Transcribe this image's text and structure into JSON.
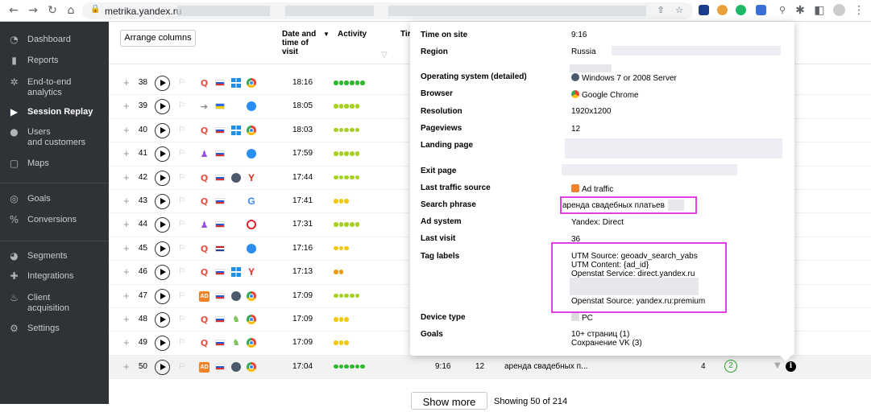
{
  "browser": {
    "url": "metrika.yandex.ru"
  },
  "sidebar": {
    "items": [
      {
        "label": "Dashboard",
        "icon": "dashboard-icon",
        "glyph": "◔"
      },
      {
        "label": "Reports",
        "icon": "reports-icon",
        "glyph": "▮"
      },
      {
        "label": "End-to-end\nanalytics",
        "icon": "analytics-icon",
        "glyph": "✲"
      },
      {
        "label": "Session Replay",
        "icon": "play-icon",
        "glyph": "▶",
        "active": true
      },
      {
        "label": "Users\nand customers",
        "icon": "users-icon",
        "glyph": "●"
      },
      {
        "label": "Maps",
        "icon": "maps-icon",
        "glyph": "▢"
      },
      {
        "label": "Goals",
        "icon": "goals-icon",
        "glyph": "◎"
      },
      {
        "label": "Conversions",
        "icon": "conversions-icon",
        "glyph": "%"
      },
      {
        "label": "Segments",
        "icon": "segments-icon",
        "glyph": "◕"
      },
      {
        "label": "Integrations",
        "icon": "integrations-icon",
        "glyph": "✚"
      },
      {
        "label": "Client\nacquisition",
        "icon": "fire-icon",
        "glyph": "♨"
      },
      {
        "label": "Settings",
        "icon": "settings-icon",
        "glyph": "⚙"
      }
    ]
  },
  "table": {
    "arrange_label": "Arrange columns",
    "headers": {
      "datetime": "Date and\ntime of\nvisit",
      "activity": "Activity",
      "time_cut": "Tir"
    },
    "rows": [
      {
        "num": "38",
        "src": "search",
        "country": "ru",
        "os": "win",
        "browser": "chrome",
        "time": "18:16",
        "dots": 6,
        "color": "#2eb82e"
      },
      {
        "num": "39",
        "src": "link",
        "country": "ua",
        "os": "none",
        "browser": "safari",
        "time": "18:05",
        "dots": 5,
        "color": "#a6d21f"
      },
      {
        "num": "40",
        "src": "search",
        "country": "ru",
        "os": "win",
        "browser": "chrome",
        "time": "18:03",
        "dots": 5,
        "color": "#a6d21f"
      },
      {
        "num": "41",
        "src": "social",
        "country": "ru",
        "os": "none",
        "browser": "safari",
        "time": "17:59",
        "dots": 5,
        "color": "#a6d21f"
      },
      {
        "num": "42",
        "src": "search",
        "country": "ru",
        "os": "w7",
        "browser": "yandex",
        "time": "17:44",
        "dots": 5,
        "color": "#a6d21f"
      },
      {
        "num": "43",
        "src": "search",
        "country": "ru",
        "os": "none",
        "browser": "google",
        "time": "17:41",
        "dots": 3,
        "color": "#f2c811"
      },
      {
        "num": "44",
        "src": "social",
        "country": "ru",
        "os": "none",
        "browser": "opera",
        "time": "17:31",
        "dots": 5,
        "color": "#a6d21f"
      },
      {
        "num": "45",
        "src": "search",
        "country": "nl",
        "os": "none",
        "browser": "safari",
        "time": "17:16",
        "dots": 3,
        "color": "#f2c811"
      },
      {
        "num": "46",
        "src": "search",
        "country": "ru",
        "os": "win",
        "browser": "yandex",
        "time": "17:13",
        "dots": 2,
        "color": "#f29b11"
      },
      {
        "num": "47",
        "src": "ad",
        "country": "ru",
        "os": "w7",
        "browser": "chrome",
        "time": "17:09",
        "dots": 5,
        "color": "#a6d21f"
      },
      {
        "num": "48",
        "src": "search",
        "country": "ru",
        "os": "and",
        "browser": "chrome",
        "time": "17:09",
        "dots": 3,
        "color": "#f2c811"
      },
      {
        "num": "49",
        "src": "search",
        "country": "ru",
        "os": "and",
        "browser": "chrome",
        "time": "17:09",
        "dots": 3,
        "color": "#f2c811"
      },
      {
        "num": "50",
        "src": "ad",
        "country": "ru",
        "os": "w7",
        "browser": "chrome",
        "time": "17:04",
        "dots": 6,
        "color": "#2eb82e",
        "highlight": true,
        "duration": "9:16",
        "pageviews": "12",
        "phrase": "аренда свадебных п...",
        "extra": "4",
        "goals": "2"
      }
    ],
    "show_more": "Show more",
    "showing": "Showing 50 of 214"
  },
  "popup": {
    "rows": [
      {
        "key": "Time on site",
        "value": "9:16"
      },
      {
        "key": "Region",
        "value": "Russia"
      },
      {
        "key": "Operating system (detailed)",
        "value": "Windows 7 or 2008 Server"
      },
      {
        "key": "Browser",
        "value": "Google Chrome"
      },
      {
        "key": "Resolution",
        "value": "1920x1200"
      },
      {
        "key": "Pageviews",
        "value": "12"
      },
      {
        "key": "Landing page",
        "value": ""
      },
      {
        "key": "Exit page",
        "value": ""
      },
      {
        "key": "Last traffic source",
        "value": "Ad traffic"
      },
      {
        "key": "Search phrase",
        "value": "аренда свадебных платьев"
      },
      {
        "key": "Ad system",
        "value": "Yandex: Direct"
      },
      {
        "key": "Last visit",
        "value": "36"
      },
      {
        "key": "Tag labels",
        "value": "UTM Source: geoadv_search_yabs"
      },
      {
        "key": "Device type",
        "value": "PC"
      },
      {
        "key": "Goals",
        "value": "10+ страниц (1)"
      }
    ],
    "tag_labels": [
      "UTM Source: geoadv_search_yabs",
      "UTM Content: {ad_id}",
      "Openstat Service: direct.yandex.ru",
      "Openstat Source: yandex.ru:premium"
    ],
    "goals": [
      "10+ страниц (1)",
      "Сохранение VK (3)"
    ]
  }
}
